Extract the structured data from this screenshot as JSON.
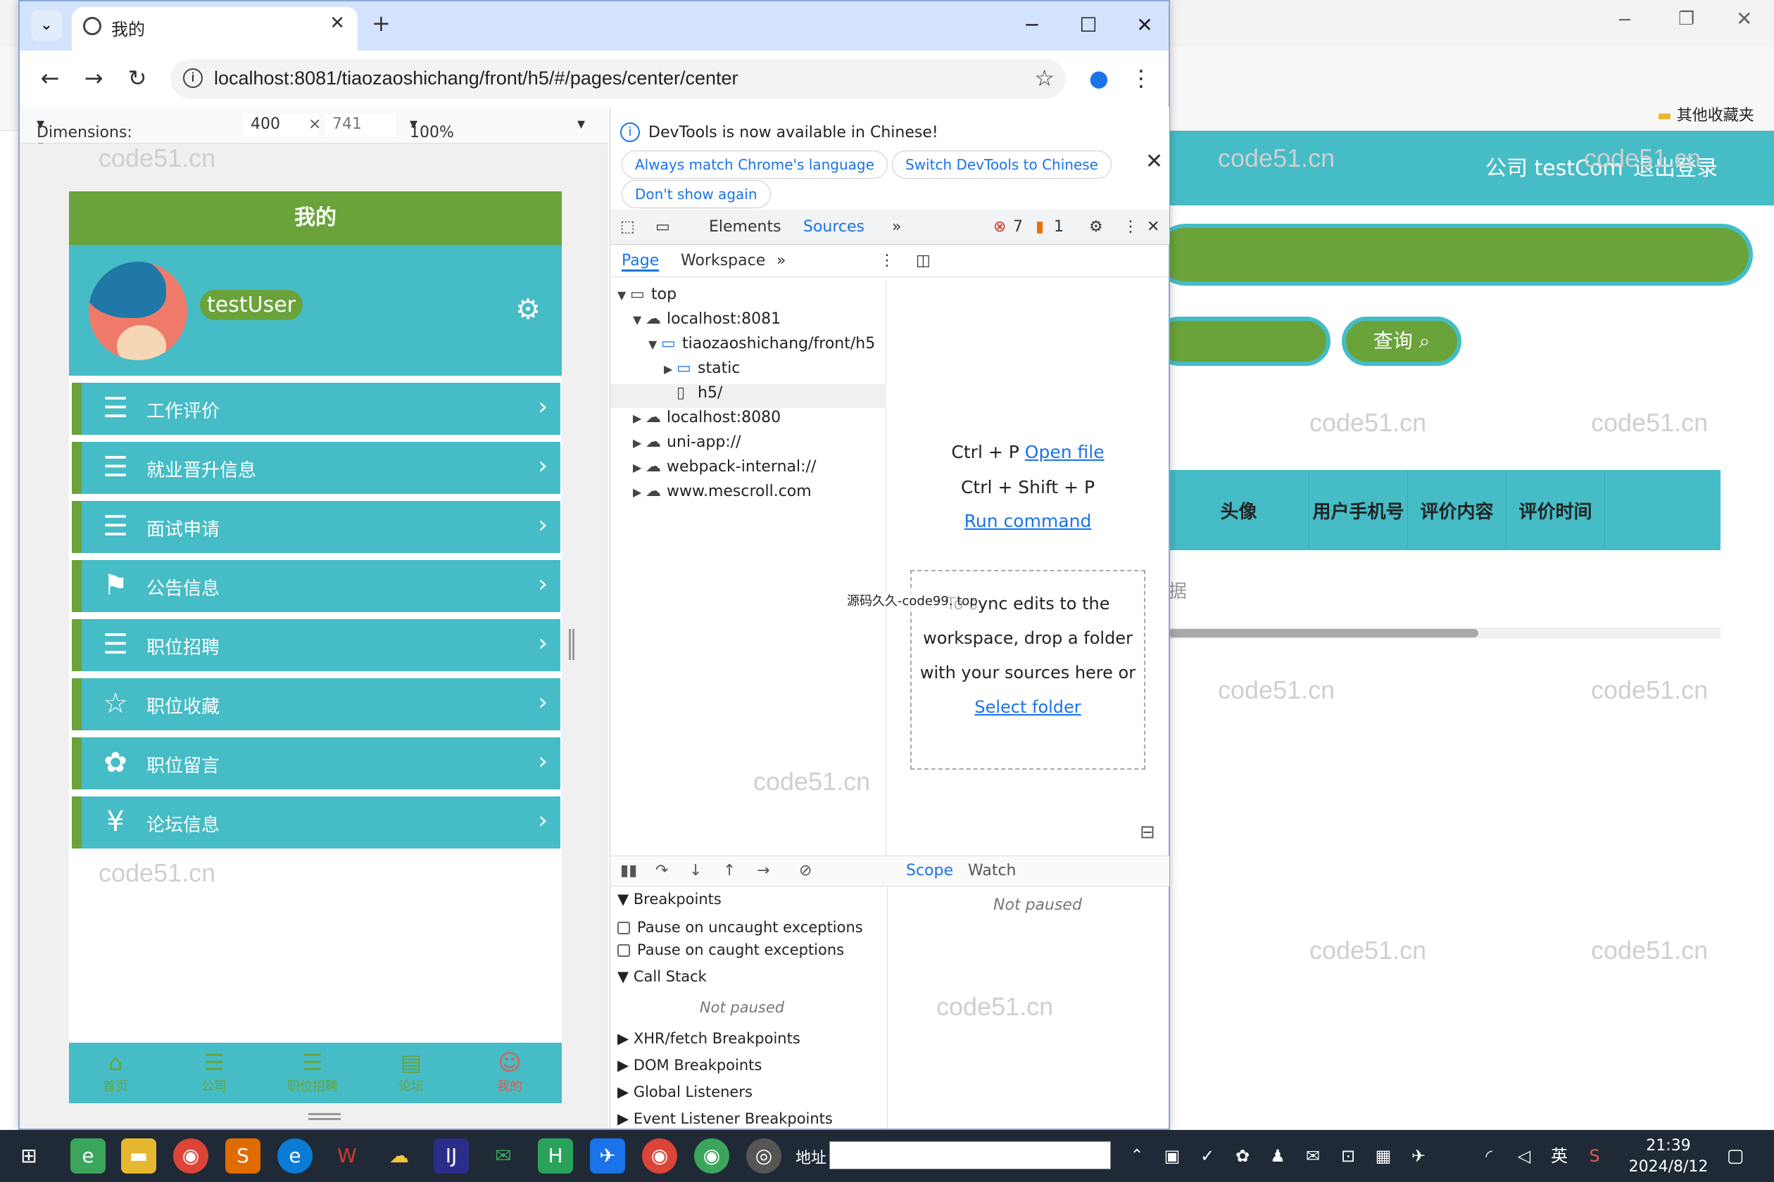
{
  "watermark": "code51.cn",
  "background_page": {
    "company_label": "公司 testCom",
    "logout_label": "退出登录",
    "query_button": "查询",
    "table_headers": [
      "头像",
      "用户手机号",
      "评价内容",
      "评价时间"
    ],
    "no_data_fragment": "据",
    "bookmark_folder": "其他收藏夹"
  },
  "browser": {
    "tab_title": "我的",
    "url": "localhost:8081/tiaozaoshichang/front/h5/#/pages/center/center"
  },
  "device_toolbar": {
    "dimensions_label": "Dimensions: Respons...",
    "width": "400",
    "height": "741",
    "zoom": "100%"
  },
  "phone": {
    "header_title": "我的",
    "username": "testUser",
    "menu": [
      {
        "label": "工作评价",
        "icon": "list-icon"
      },
      {
        "label": "就业晋升信息",
        "icon": "list-icon"
      },
      {
        "label": "面试申请",
        "icon": "list-icon"
      },
      {
        "label": "公告信息",
        "icon": "flag-icon"
      },
      {
        "label": "职位招聘",
        "icon": "list-icon"
      },
      {
        "label": "职位收藏",
        "icon": "star-icon"
      },
      {
        "label": "职位留言",
        "icon": "flower-icon"
      },
      {
        "label": "论坛信息",
        "icon": "money-bag-icon"
      }
    ],
    "tabbar": [
      {
        "label": "首页",
        "icon": "home-icon"
      },
      {
        "label": "公司",
        "icon": "list-icon"
      },
      {
        "label": "职位招聘",
        "icon": "list-icon"
      },
      {
        "label": "论坛",
        "icon": "doc-icon"
      },
      {
        "label": "我的",
        "icon": "user-icon"
      }
    ]
  },
  "devtools": {
    "banner_text": "DevTools is now available in Chinese!",
    "chip_match": "Always match Chrome's language",
    "chip_switch": "Switch DevTools to Chinese",
    "chip_dont_show": "Don't show again",
    "tab_elements": "Elements",
    "tab_sources": "Sources",
    "errors_count": "7",
    "warnings_count": "1",
    "subtab_page": "Page",
    "subtab_workspace": "Workspace",
    "tree": [
      {
        "label": "top",
        "icon": "frame"
      },
      {
        "label": "localhost:8081",
        "icon": "cloud"
      },
      {
        "label": "tiaozaoshichang/front/h5",
        "icon": "folder"
      },
      {
        "label": "static",
        "icon": "folder"
      },
      {
        "label": "h5/",
        "icon": "file"
      },
      {
        "label": "localhost:8080",
        "icon": "cloud"
      },
      {
        "label": "uni-app://",
        "icon": "cloud"
      },
      {
        "label": "webpack-internal://",
        "icon": "cloud"
      },
      {
        "label": "www.mescroll.com",
        "icon": "cloud"
      }
    ],
    "editor": {
      "shortcut_open": "Ctrl + P",
      "open_file": "Open file",
      "shortcut_run": "Ctrl + Shift + P",
      "run_command": "Run command",
      "drop_text": "To sync edits to the workspace, drop a folder with your sources here or",
      "select_folder": "Select folder"
    },
    "overlay_text": "源码久久-code99. top",
    "scope_tab": "Scope",
    "watch_tab": "Watch",
    "not_paused": "Not paused",
    "breakpoints": {
      "breakpoints_header": "Breakpoints",
      "pause_uncaught": "Pause on uncaught exceptions",
      "pause_caught": "Pause on caught exceptions",
      "call_stack": "Call Stack",
      "not_paused": "Not paused",
      "xhr": "XHR/fetch Breakpoints",
      "dom": "DOM Breakpoints",
      "global": "Global Listeners",
      "event": "Event Listener Breakpoints"
    }
  },
  "taskbar": {
    "address_label": "地址",
    "ime": "英",
    "time": "21:39",
    "date": "2024/8/12"
  }
}
